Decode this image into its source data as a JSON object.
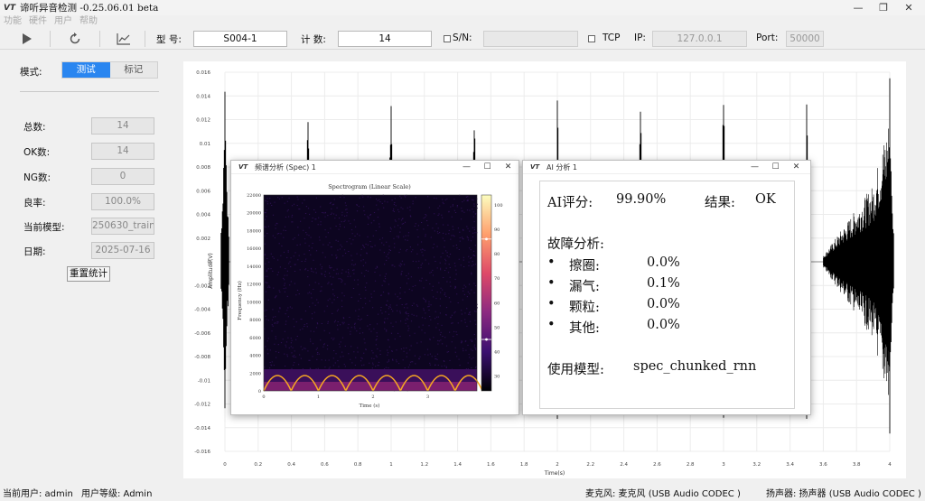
{
  "app": {
    "title": "谛听异音检测 -0.25.06.01 beta",
    "icon": "app-logo-icon"
  },
  "menu": [
    "功能",
    "硬件",
    "用户",
    "帮助"
  ],
  "toolbar": {
    "model_label": "型 号:",
    "model_value": "S004-1",
    "count_label": "计 数:",
    "count_value": "14",
    "sn_label": "S/N:",
    "sn_value": "",
    "tcp_label": "TCP",
    "ip_label": "IP:",
    "ip_value": "127.0.0.1",
    "port_label": "Port:",
    "port_value": "50000"
  },
  "left": {
    "mode_label": "模式:",
    "tabs": [
      "测试",
      "标记"
    ],
    "active_tab": 0,
    "stats": [
      {
        "label": "总数:",
        "value": "14"
      },
      {
        "label": "OK数:",
        "value": "14"
      },
      {
        "label": "NG数:",
        "value": "0"
      },
      {
        "label": "良率:",
        "value": "100.0%"
      },
      {
        "label": "当前模型:",
        "value": "250630_train"
      },
      {
        "label": "日期:",
        "value": "2025-07-16"
      }
    ],
    "reset_label": "重置统计"
  },
  "main_plot": {
    "ylabel": "Amplitude(V)",
    "xlabel": "Time(s)",
    "yticks": [
      "0.016",
      "0.014",
      "0.012",
      "0.01",
      "0.008",
      "0.006",
      "0.004",
      "0.002",
      "0",
      "-0.002",
      "-0.004",
      "-0.006",
      "-0.008",
      "-0.01",
      "-0.012",
      "-0.014",
      "-0.016"
    ],
    "xticks": [
      "0",
      "0.2",
      "0.4",
      "0.6",
      "0.8",
      "1",
      "1.2",
      "1.4",
      "1.6",
      "1.8",
      "2",
      "2.2",
      "2.4",
      "2.6",
      "2.8",
      "3",
      "3.2",
      "3.4",
      "3.6",
      "3.8",
      "4"
    ],
    "pulse_times": [
      0,
      0.5,
      1.0,
      1.5,
      2.0,
      2.5,
      3.0,
      3.5,
      4.0
    ],
    "ylim": [
      -0.016,
      0.016
    ],
    "xlim": [
      0,
      4
    ]
  },
  "spec_window": {
    "title": "频谱分析 (Spec) 1",
    "plot_title": "Spectrogram (Linear Scale)",
    "ylabel": "Frequency (Hz)",
    "xlabel": "Time (s)",
    "yticks": [
      "22000",
      "20000",
      "18000",
      "16000",
      "14000",
      "12000",
      "10000",
      "8000",
      "6000",
      "4000",
      "2000",
      "0"
    ],
    "xticks": [
      "0",
      "1",
      "2",
      "3"
    ],
    "cbar_ticks": [
      "100",
      "90",
      "80",
      "70",
      "60",
      "50",
      "40",
      "30"
    ]
  },
  "ai_window": {
    "title": "AI 分析 1",
    "score_label": "AI评分:",
    "score_value": "99.90%",
    "result_label": "结果:",
    "result_value": "OK",
    "fault_title": "故障分析:",
    "faults": [
      {
        "name": "擦圈:",
        "value": "0.0%"
      },
      {
        "name": "漏气:",
        "value": "0.1%"
      },
      {
        "name": "颗粒:",
        "value": "0.0%"
      },
      {
        "name": "其他:",
        "value": "0.0%"
      }
    ],
    "model_label": "使用模型:",
    "model_value": "spec_chunked_rnn"
  },
  "status": {
    "user": "当前用户: admin",
    "level": "用户等级: Admin",
    "mic": "麦克风: 麦克风 (USB Audio CODEC )",
    "speaker": "扬声器: 扬声器 (USB Audio CODEC )"
  }
}
